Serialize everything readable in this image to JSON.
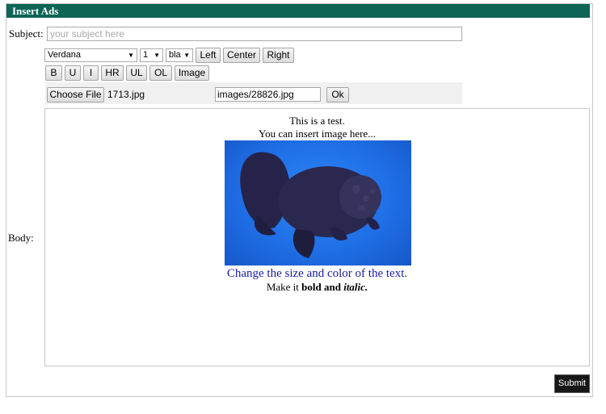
{
  "header": {
    "title": "Insert Ads"
  },
  "form": {
    "subject_label": "Subject:",
    "subject_placeholder": "your subject here",
    "body_label": "Body:"
  },
  "toolbar": {
    "font_select": "Verdana",
    "size_select": "1",
    "color_select": "bla",
    "align_buttons": [
      "Left",
      "Center",
      "Right"
    ],
    "format_buttons": [
      "B",
      "U",
      "I",
      "HR",
      "UL",
      "OL",
      "Image"
    ]
  },
  "file_upload": {
    "choose_label": "Choose File",
    "chosen_file": "1713.jpg",
    "path_value": "images/28826.jpg",
    "ok_label": "Ok"
  },
  "body_content": {
    "line1": "This is a test.",
    "line2": "You can insert image here...",
    "line3": "Change the size and color of the text.",
    "line4_prefix": "Make it ",
    "line4_bold": "bold and ",
    "line4_bold_italic": "italic.",
    "line3_color": "#1a1aa6"
  },
  "submit_label": "Submit",
  "colors": {
    "header_bg": "#0e6455",
    "submit_bg": "#171717"
  }
}
